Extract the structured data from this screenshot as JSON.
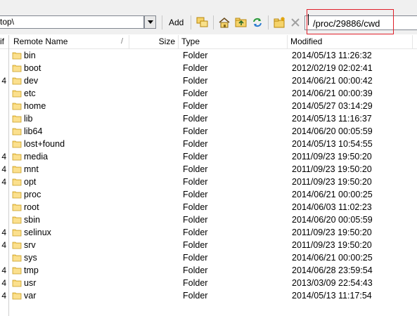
{
  "toolbar": {
    "left_path": "top\\",
    "add_label": "Add",
    "remote_path": "/proc/29886/cwd"
  },
  "header": {
    "stub": "if",
    "columns": [
      "Remote Name",
      "Size",
      "Type",
      "Modified"
    ],
    "sort_indicator": "/"
  },
  "rows": [
    {
      "stub": "",
      "name": "bin",
      "type": "Folder",
      "modified": "2014/05/13 11:26:32"
    },
    {
      "stub": "",
      "name": "boot",
      "type": "Folder",
      "modified": "2012/02/19 02:02:41"
    },
    {
      "stub": "4",
      "name": "dev",
      "type": "Folder",
      "modified": "2014/06/21 00:00:42"
    },
    {
      "stub": "",
      "name": "etc",
      "type": "Folder",
      "modified": "2014/06/21 00:00:39"
    },
    {
      "stub": "",
      "name": "home",
      "type": "Folder",
      "modified": "2014/05/27 03:14:29"
    },
    {
      "stub": "",
      "name": "lib",
      "type": "Folder",
      "modified": "2014/05/13 11:16:37"
    },
    {
      "stub": "",
      "name": "lib64",
      "type": "Folder",
      "modified": "2014/06/20 00:05:59"
    },
    {
      "stub": "",
      "name": "lost+found",
      "type": "Folder",
      "modified": "2014/05/13 10:54:55"
    },
    {
      "stub": "4",
      "name": "media",
      "type": "Folder",
      "modified": "2011/09/23 19:50:20"
    },
    {
      "stub": "4",
      "name": "mnt",
      "type": "Folder",
      "modified": "2011/09/23 19:50:20"
    },
    {
      "stub": "4",
      "name": "opt",
      "type": "Folder",
      "modified": "2011/09/23 19:50:20"
    },
    {
      "stub": "",
      "name": "proc",
      "type": "Folder",
      "modified": "2014/06/21 00:00:25"
    },
    {
      "stub": "",
      "name": "root",
      "type": "Folder",
      "modified": "2014/06/03 11:02:23"
    },
    {
      "stub": "",
      "name": "sbin",
      "type": "Folder",
      "modified": "2014/06/20 00:05:59"
    },
    {
      "stub": "4",
      "name": "selinux",
      "type": "Folder",
      "modified": "2011/09/23 19:50:20"
    },
    {
      "stub": "4",
      "name": "srv",
      "type": "Folder",
      "modified": "2011/09/23 19:50:20"
    },
    {
      "stub": "",
      "name": "sys",
      "type": "Folder",
      "modified": "2014/06/21 00:00:25"
    },
    {
      "stub": "4",
      "name": "tmp",
      "type": "Folder",
      "modified": "2014/06/28 23:59:54"
    },
    {
      "stub": "4",
      "name": "usr",
      "type": "Folder",
      "modified": "2013/03/09 22:54:43"
    },
    {
      "stub": "4",
      "name": "var",
      "type": "Folder",
      "modified": "2014/05/13 11:17:54"
    }
  ]
}
